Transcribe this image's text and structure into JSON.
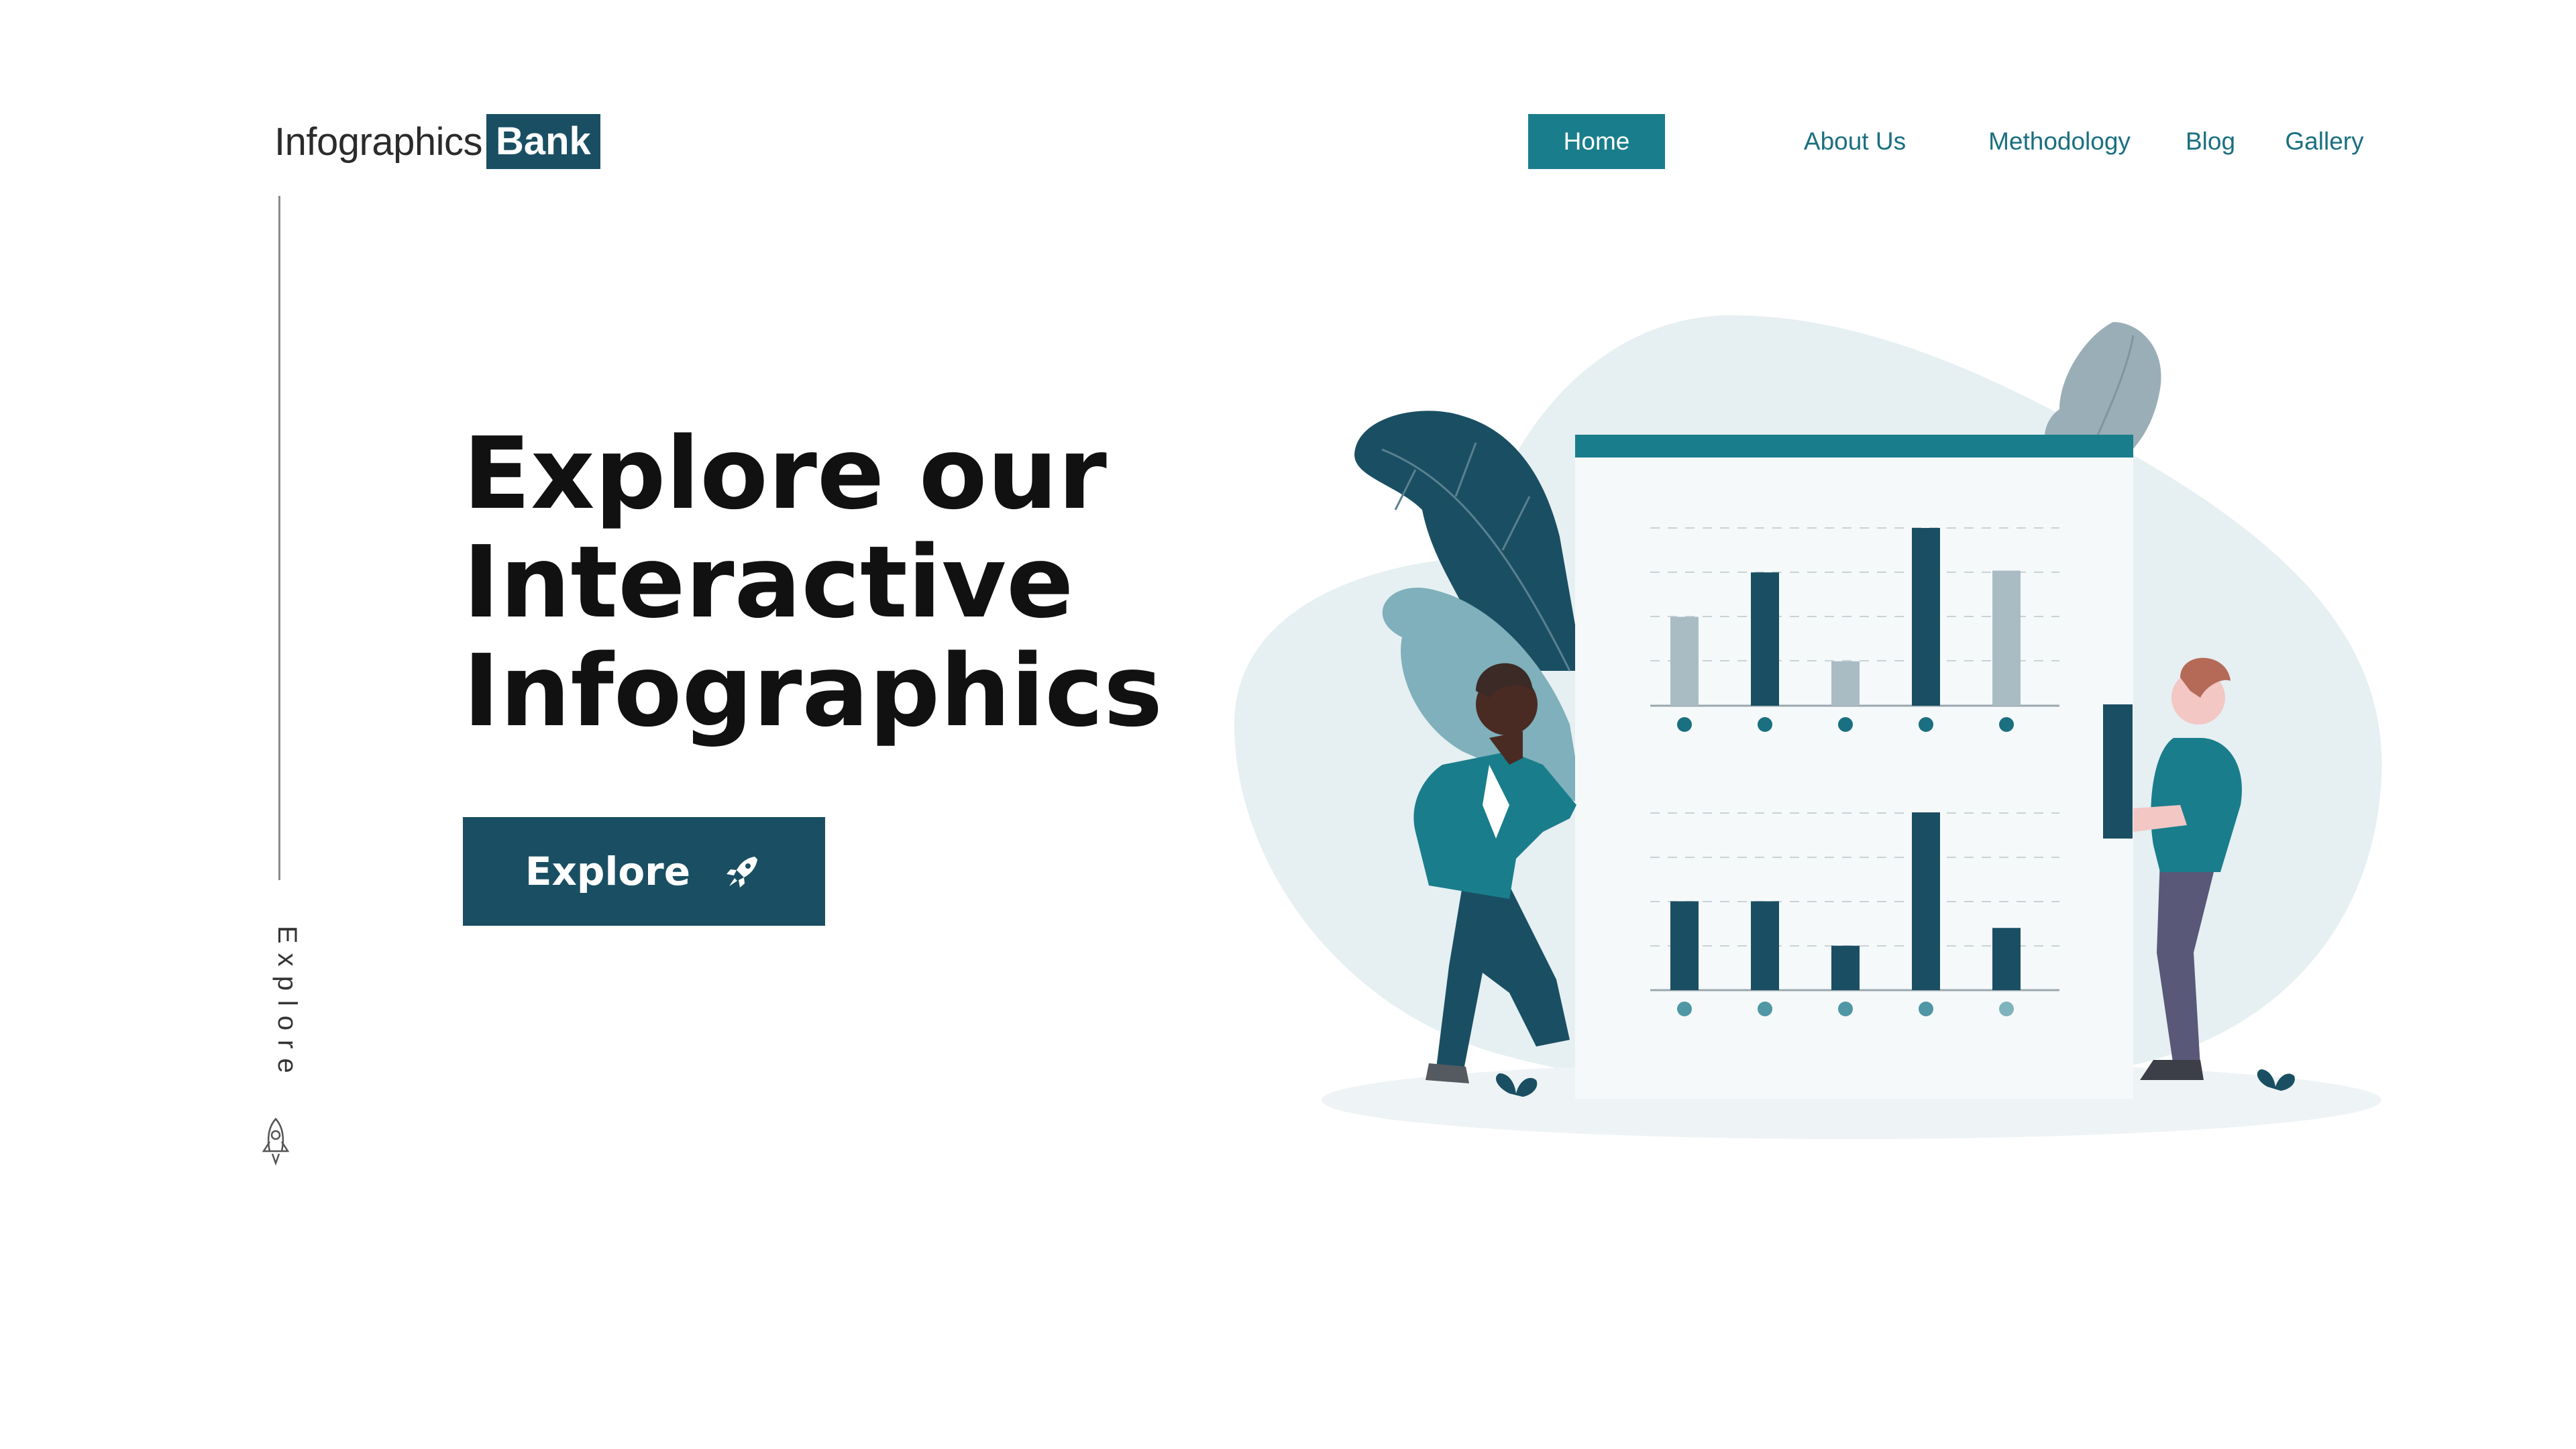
{
  "brand": {
    "name_light": "Infographics",
    "name_bold": "Bank",
    "color": "#1a4f63"
  },
  "nav": {
    "items": [
      {
        "label": "Home",
        "active": true
      },
      {
        "label": "About Us",
        "active": false
      },
      {
        "label": "Methodology",
        "active": false
      },
      {
        "label": "Blog",
        "active": false
      },
      {
        "label": "Gallery",
        "active": false
      }
    ],
    "accent": "#1a7d8c"
  },
  "sidebar": {
    "label": "Explore",
    "icon": "rocket-icon"
  },
  "hero": {
    "title_line1": "Explore our",
    "title_line2": "Interactive",
    "title_line3": "Infographics",
    "button_label": "Explore",
    "button_icon": "rocket-icon"
  },
  "illustration": {
    "chart_top": {
      "values": [
        0.5,
        0.75,
        0.25,
        1.0,
        0.76
      ],
      "dark": [
        false,
        true,
        false,
        true,
        false
      ]
    },
    "chart_bottom": {
      "values": [
        0.5,
        0.5,
        0.25,
        1.0,
        0.35
      ]
    },
    "colors": {
      "dark": "#1a4f63",
      "light": "#a9bcc4",
      "blob": "#e6eff2",
      "header": "#1a7d8c"
    }
  }
}
